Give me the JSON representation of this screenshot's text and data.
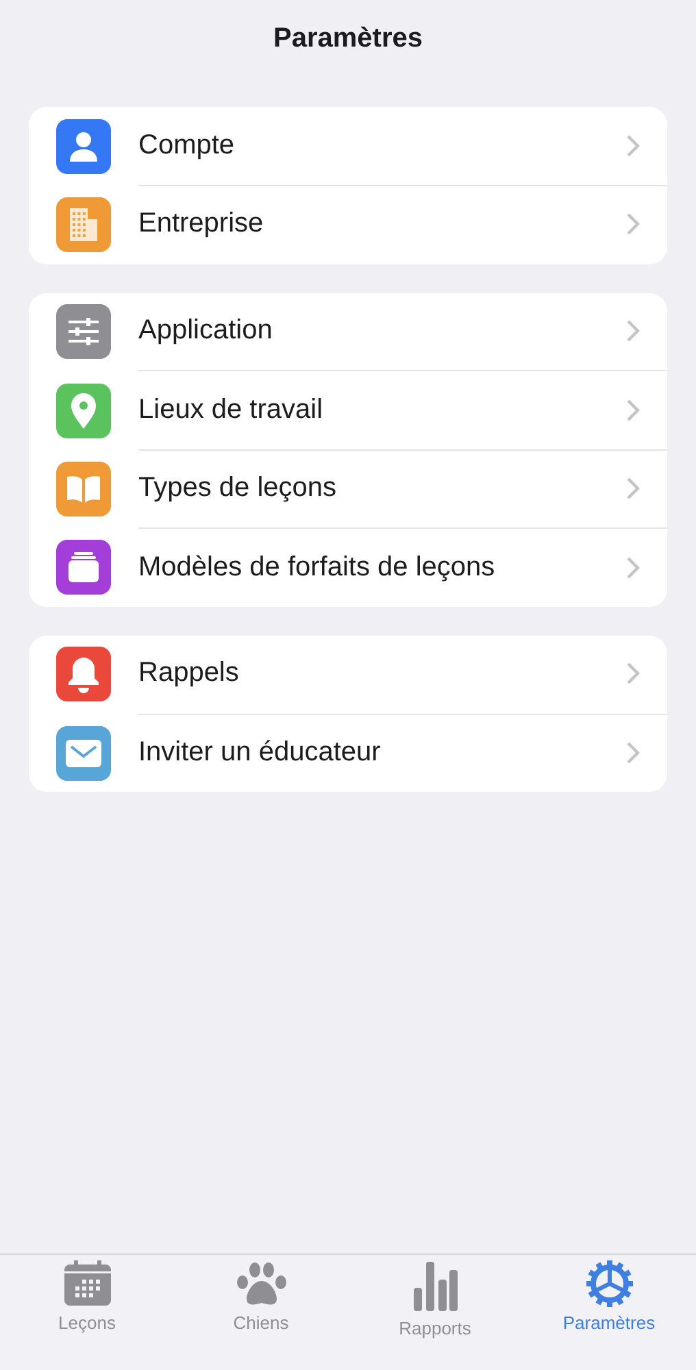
{
  "header": {
    "title": "Paramètres"
  },
  "groups": [
    {
      "items": [
        {
          "label": "Compte",
          "kind": "person",
          "color": "#3478f6"
        },
        {
          "label": "Entreprise",
          "kind": "building",
          "color": "#f09a37"
        }
      ]
    },
    {
      "items": [
        {
          "label": "Application",
          "kind": "sliders",
          "color": "#8e8e93"
        },
        {
          "label": "Lieux de travail",
          "kind": "pin",
          "color": "#5ac35e"
        },
        {
          "label": "Types de leçons",
          "kind": "book",
          "color": "#f09a37"
        },
        {
          "label": "Modèles de forfaits de leçons",
          "kind": "tray",
          "color": "#a33fd8"
        }
      ]
    },
    {
      "items": [
        {
          "label": "Rappels",
          "kind": "bell",
          "color": "#e9483b"
        },
        {
          "label": "Inviter un éducateur",
          "kind": "mail",
          "color": "#58a6d8"
        }
      ]
    }
  ],
  "tab_bar": [
    {
      "label": "Leçons",
      "kind": "calendar",
      "selected": false
    },
    {
      "label": "Chiens",
      "kind": "paw",
      "selected": false
    },
    {
      "label": "Rapports",
      "kind": "bars",
      "selected": false
    },
    {
      "label": "Paramètres",
      "kind": "gear",
      "selected": true
    }
  ]
}
